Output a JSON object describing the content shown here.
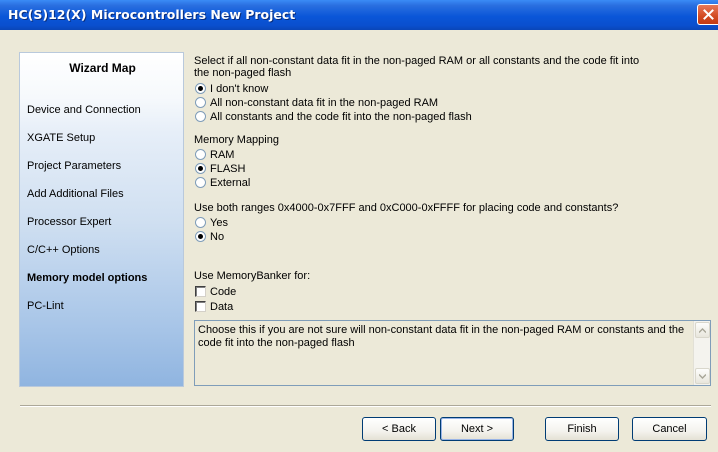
{
  "window": {
    "title": "HC(S)12(X) Microcontrollers New Project"
  },
  "wizard_map": {
    "title": "Wizard Map",
    "items": [
      {
        "label": "Device and Connection",
        "active": false
      },
      {
        "label": "XGATE Setup",
        "active": false
      },
      {
        "label": "Project Parameters",
        "active": false
      },
      {
        "label": "Add Additional Files",
        "active": false
      },
      {
        "label": "Processor Expert",
        "active": false
      },
      {
        "label": "C/C++ Options",
        "active": false
      },
      {
        "label": "Memory model options",
        "active": true
      },
      {
        "label": "PC-Lint",
        "active": false
      }
    ]
  },
  "data_fit": {
    "question_line1": "Select if all non-constant data fit in the non-paged RAM or all constants and the code fit into",
    "question_line2": "the non-paged flash",
    "options": [
      {
        "label": "I don't know",
        "checked": true
      },
      {
        "label": "All non-constant data fit in the non-paged RAM",
        "checked": false
      },
      {
        "label": "All constants and the code fit into the non-paged flash",
        "checked": false
      }
    ]
  },
  "memory_mapping": {
    "label": "Memory Mapping",
    "options": [
      {
        "label": "RAM",
        "checked": false
      },
      {
        "label": "FLASH",
        "checked": true
      },
      {
        "label": "External",
        "checked": false
      }
    ]
  },
  "ranges": {
    "question": "Use both ranges 0x4000-0x7FFF and 0xC000-0xFFFF for placing code and constants?",
    "options": [
      {
        "label": "Yes",
        "checked": false
      },
      {
        "label": "No",
        "checked": true
      }
    ]
  },
  "memory_banker": {
    "label": "Use MemoryBanker for:",
    "options": [
      {
        "label": "Code",
        "checked": false
      },
      {
        "label": "Data",
        "checked": false
      }
    ]
  },
  "description": {
    "text": "Choose this if you are not sure will non-constant data fit in the non-paged RAM or constants and the code fit into the non-paged flash"
  },
  "buttons": {
    "back": "< Back",
    "next": "Next >",
    "finish": "Finish",
    "cancel": "Cancel"
  },
  "colors": {
    "titlebar": "#0a56d8",
    "close": "#d24a22",
    "dialog_bg": "#ece9d8"
  }
}
